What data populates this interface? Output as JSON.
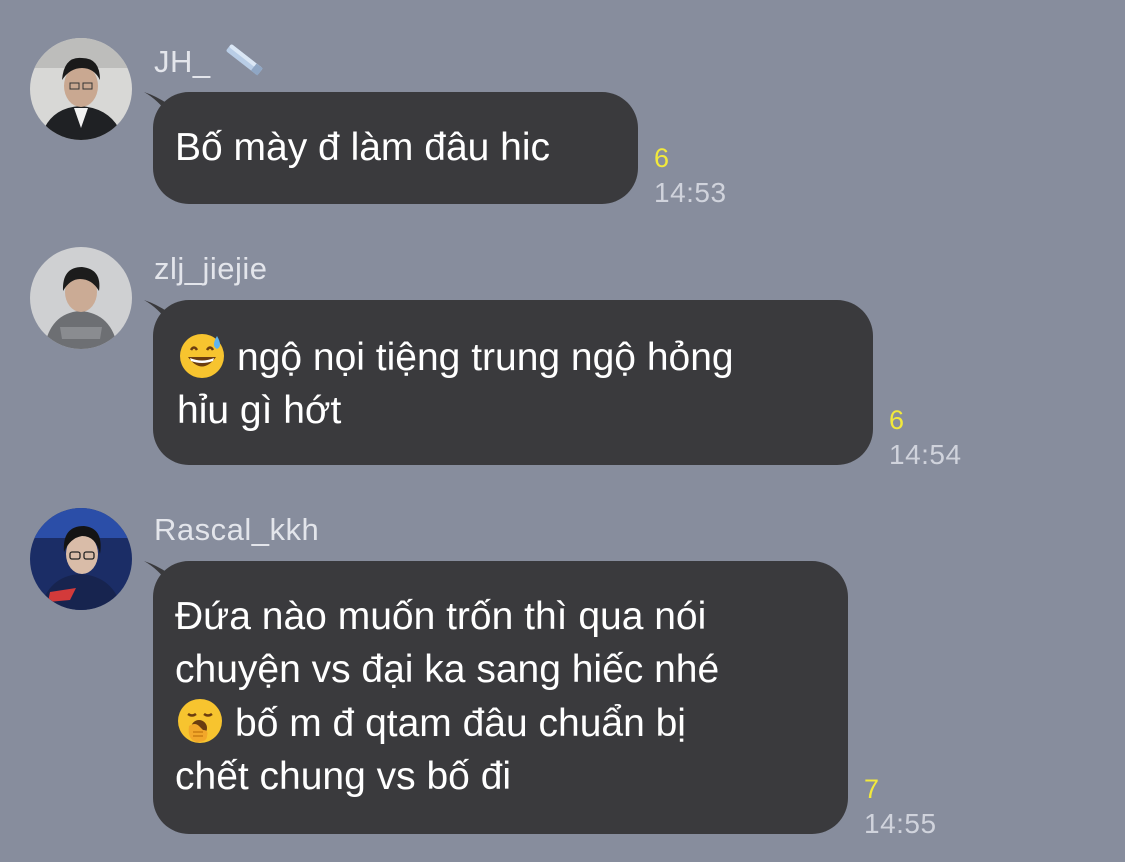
{
  "messages": [
    {
      "sender": "JH_",
      "sender_badge_icon": "pencil-icon",
      "lines": [
        "Bố mày đ làm đâu hic"
      ],
      "read_count": "6",
      "time": "14:53"
    },
    {
      "sender": "zlj_jiejie",
      "emoji_icon": "grinning-sweat-emoji",
      "lines": [
        "ngộ nọi tiệng trung ngộ hỏng",
        "hỉu gì hớt"
      ],
      "read_count": "6",
      "time": "14:54"
    },
    {
      "sender": "Rascal_kkh",
      "emoji_icon": "yawning-face-emoji",
      "lines": [
        "Đứa nào muốn trốn thì qua nói",
        "chuyện vs đại ka sang hiếc nhé",
        "bố m đ qtam đâu chuẩn bị",
        "chết chung vs bố đi"
      ],
      "read_count": "7",
      "time": "14:55"
    }
  ],
  "colors": {
    "background": "#878d9d",
    "bubble": "#3a3a3d",
    "read_count": "#f2e93b",
    "timestamp": "#d0d3dc"
  }
}
